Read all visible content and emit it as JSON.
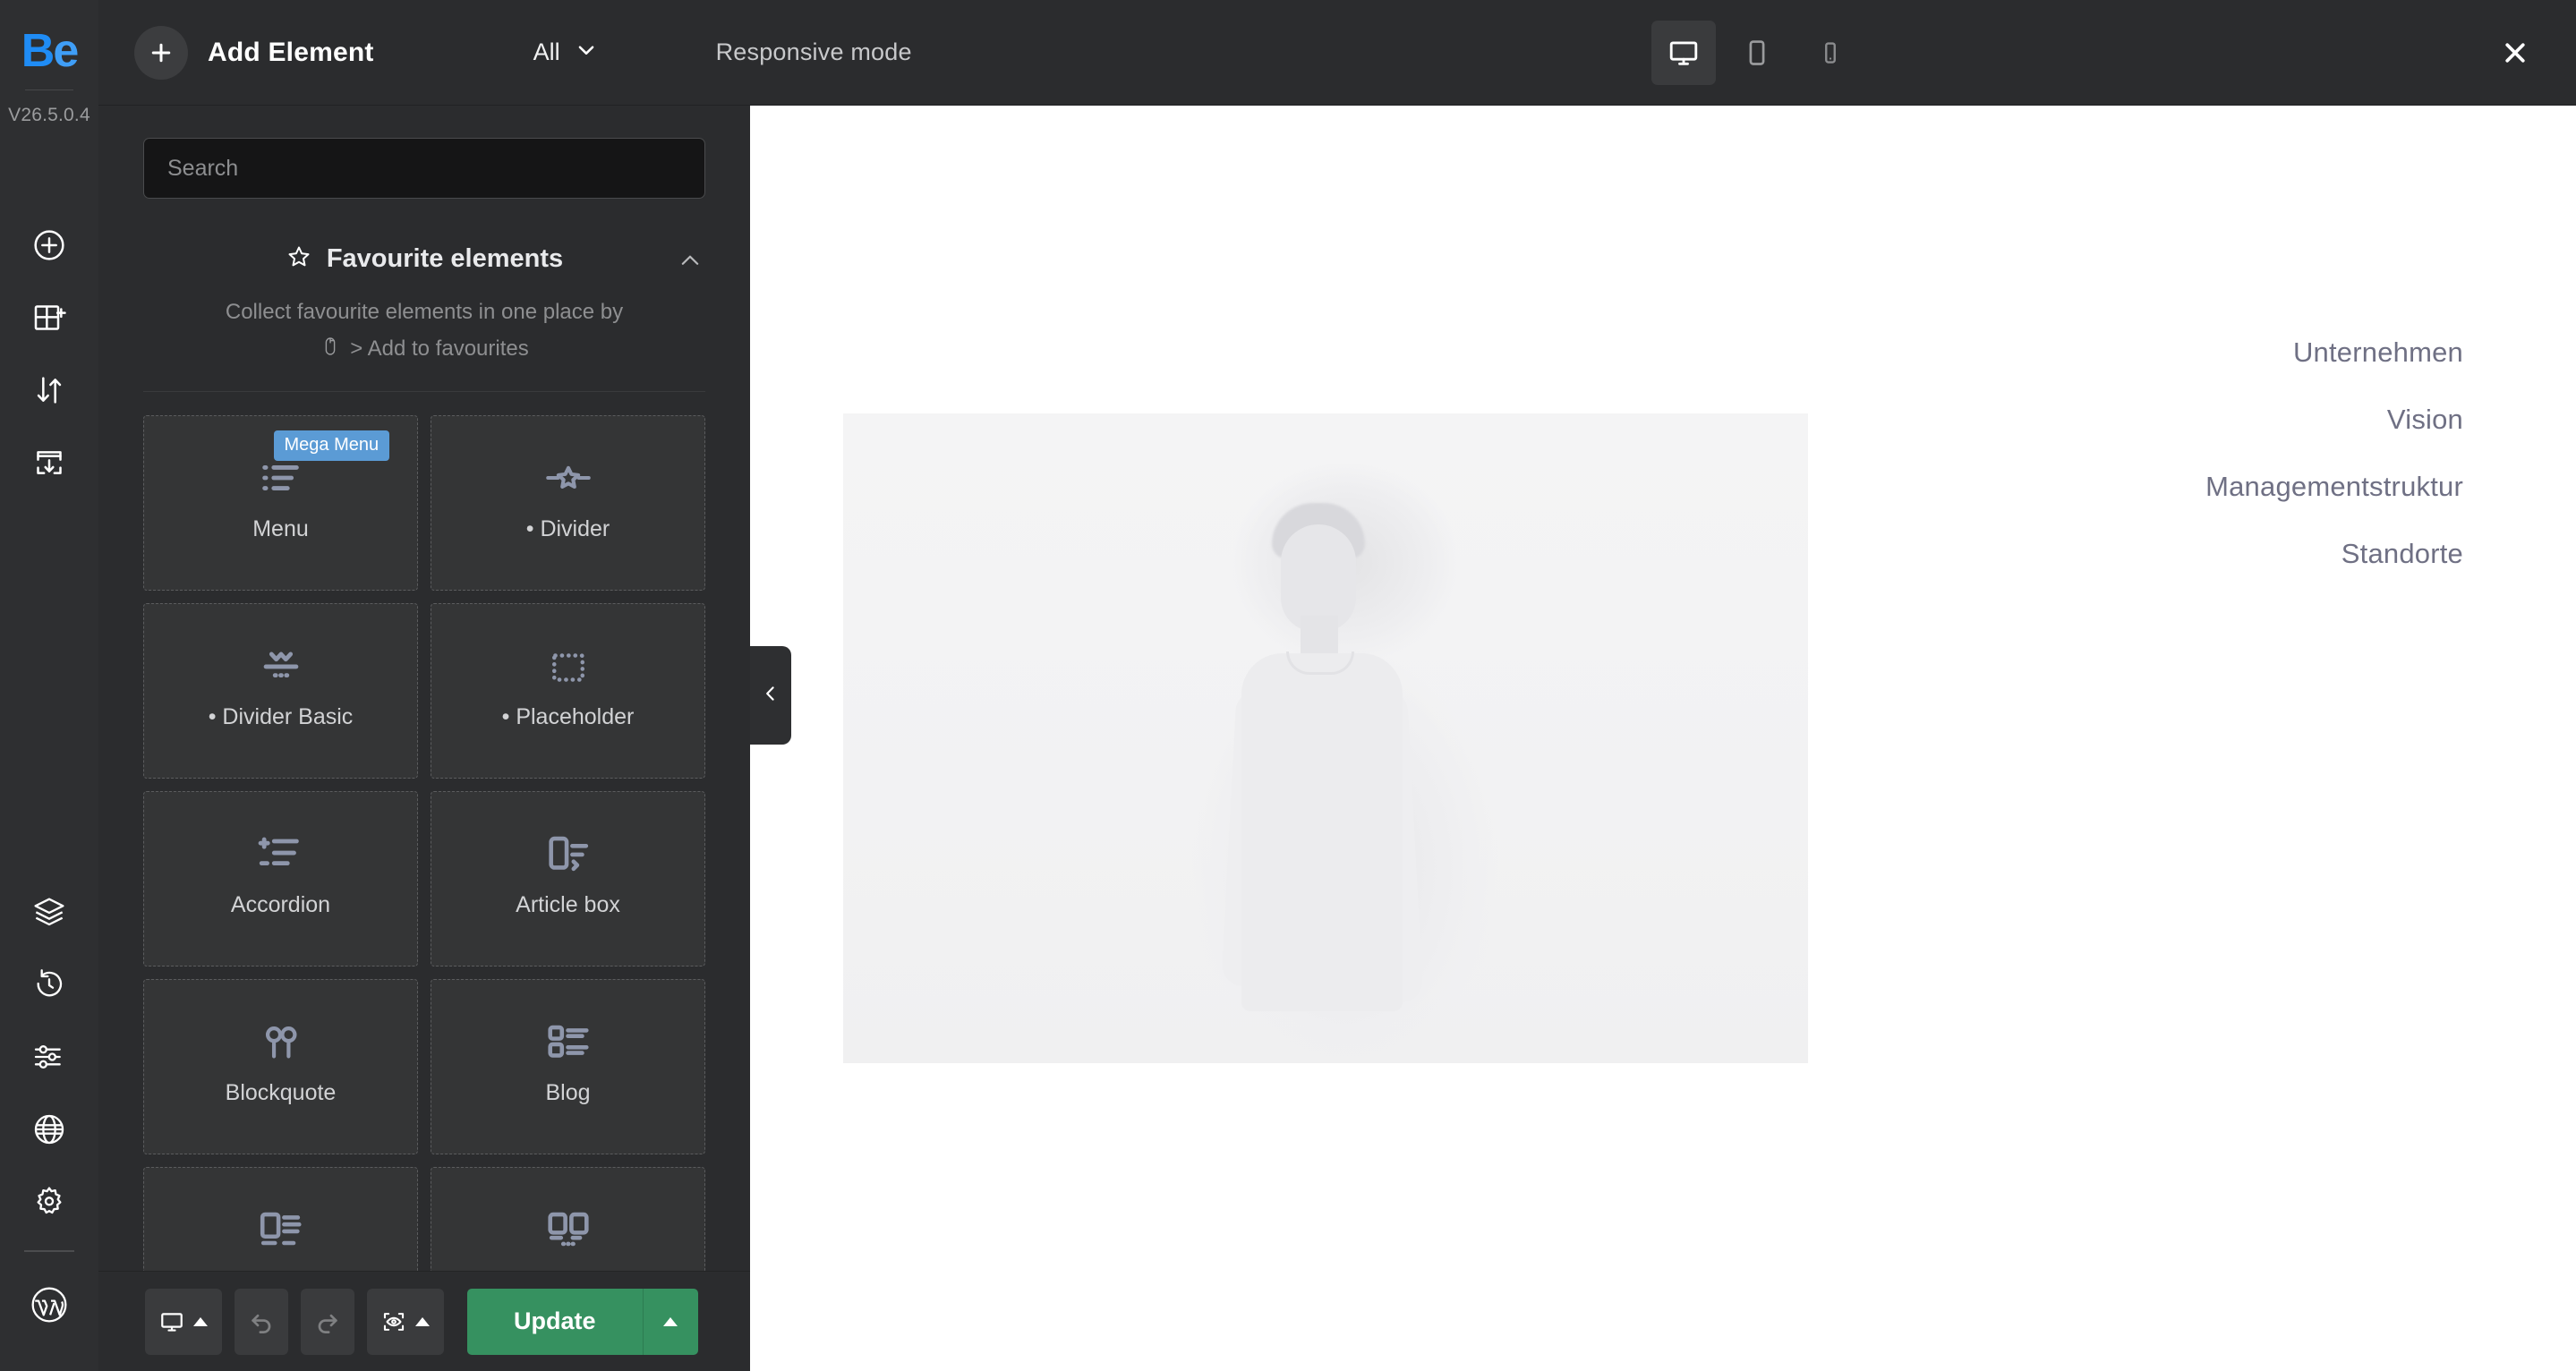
{
  "rail": {
    "logo_b": "Be",
    "logo_b_first": "B",
    "logo_b_second": "e",
    "version": "V26.5.0.4",
    "icons_top": [
      {
        "name": "add-element-icon",
        "title": "Add element"
      },
      {
        "name": "add-section-icon",
        "title": "Add section"
      },
      {
        "name": "reorder-icon",
        "title": "Reorder"
      },
      {
        "name": "insert-template-icon",
        "title": "Insert template"
      }
    ],
    "icons_bottom": [
      {
        "name": "layers-icon",
        "title": "Layers"
      },
      {
        "name": "history-icon",
        "title": "History"
      },
      {
        "name": "options-icon",
        "title": "Options"
      },
      {
        "name": "globe-icon",
        "title": "Global"
      },
      {
        "name": "gear-icon",
        "title": "Settings"
      }
    ],
    "wordpress_icon": "wordpress-icon"
  },
  "topbar": {
    "add_element_label": "Add Element",
    "plus_icon": "plus-icon",
    "filter_label": "All",
    "filter_chevron_icon": "chevron-down-icon",
    "responsive_label": "Responsive mode",
    "devices": [
      {
        "name": "desktop",
        "icon": "desktop-icon",
        "active": true
      },
      {
        "name": "tablet",
        "icon": "tablet-icon",
        "active": false
      },
      {
        "name": "mobile",
        "icon": "mobile-icon",
        "active": false
      }
    ],
    "close_icon": "close-icon"
  },
  "panel": {
    "search": {
      "placeholder": "Search",
      "value": "",
      "icon": "search-input"
    },
    "favourites": {
      "star_icon": "star-icon",
      "title": "Favourite elements",
      "collapse_icon": "chevron-up-icon",
      "description_line1": "Collect favourite elements in one place by",
      "mouse_icon": "mouse-right-click-icon",
      "description_line2": "> Add to favourites"
    },
    "elements": [
      {
        "label": "Menu",
        "icon": "menu-list-icon",
        "badge": "Mega Menu"
      },
      {
        "label": "• Divider",
        "icon": "divider-star-icon",
        "badge": ""
      },
      {
        "label": "• Divider Basic",
        "icon": "divider-basic-icon",
        "badge": ""
      },
      {
        "label": "• Placeholder",
        "icon": "placeholder-dotted-icon",
        "badge": ""
      },
      {
        "label": "Accordion",
        "icon": "accordion-icon",
        "badge": ""
      },
      {
        "label": "Article box",
        "icon": "article-box-icon",
        "badge": ""
      },
      {
        "label": "Blockquote",
        "icon": "blockquote-icon",
        "badge": ""
      },
      {
        "label": "Blog",
        "icon": "blog-list-icon",
        "badge": ""
      },
      {
        "label": "",
        "icon": "media-text-icon",
        "badge": ""
      },
      {
        "label": "",
        "icon": "two-column-cards-icon",
        "badge": ""
      }
    ],
    "toolbar": {
      "device_icon": "desktop-icon",
      "undo_icon": "undo-icon",
      "redo_icon": "redo-icon",
      "preview_icon": "preview-eye-icon",
      "update_label": "Update",
      "update_caret_icon": "caret-up-icon"
    },
    "collapse_handle_icon": "chevron-left-icon"
  },
  "canvas": {
    "hero_image_alt": "man-in-light-sweater-photo",
    "nav_items": [
      {
        "label": "Unternehmen"
      },
      {
        "label": "Vision"
      },
      {
        "label": "Managementstruktur"
      },
      {
        "label": "Standorte"
      }
    ]
  },
  "colors": {
    "brand_blue": "#1f8cf5",
    "badge_blue": "#5b9bd5",
    "update_green": "#369160",
    "panel_bg": "#2b2c2e",
    "rail_bg": "#2e2f31",
    "nav_text": "#6f7084"
  }
}
